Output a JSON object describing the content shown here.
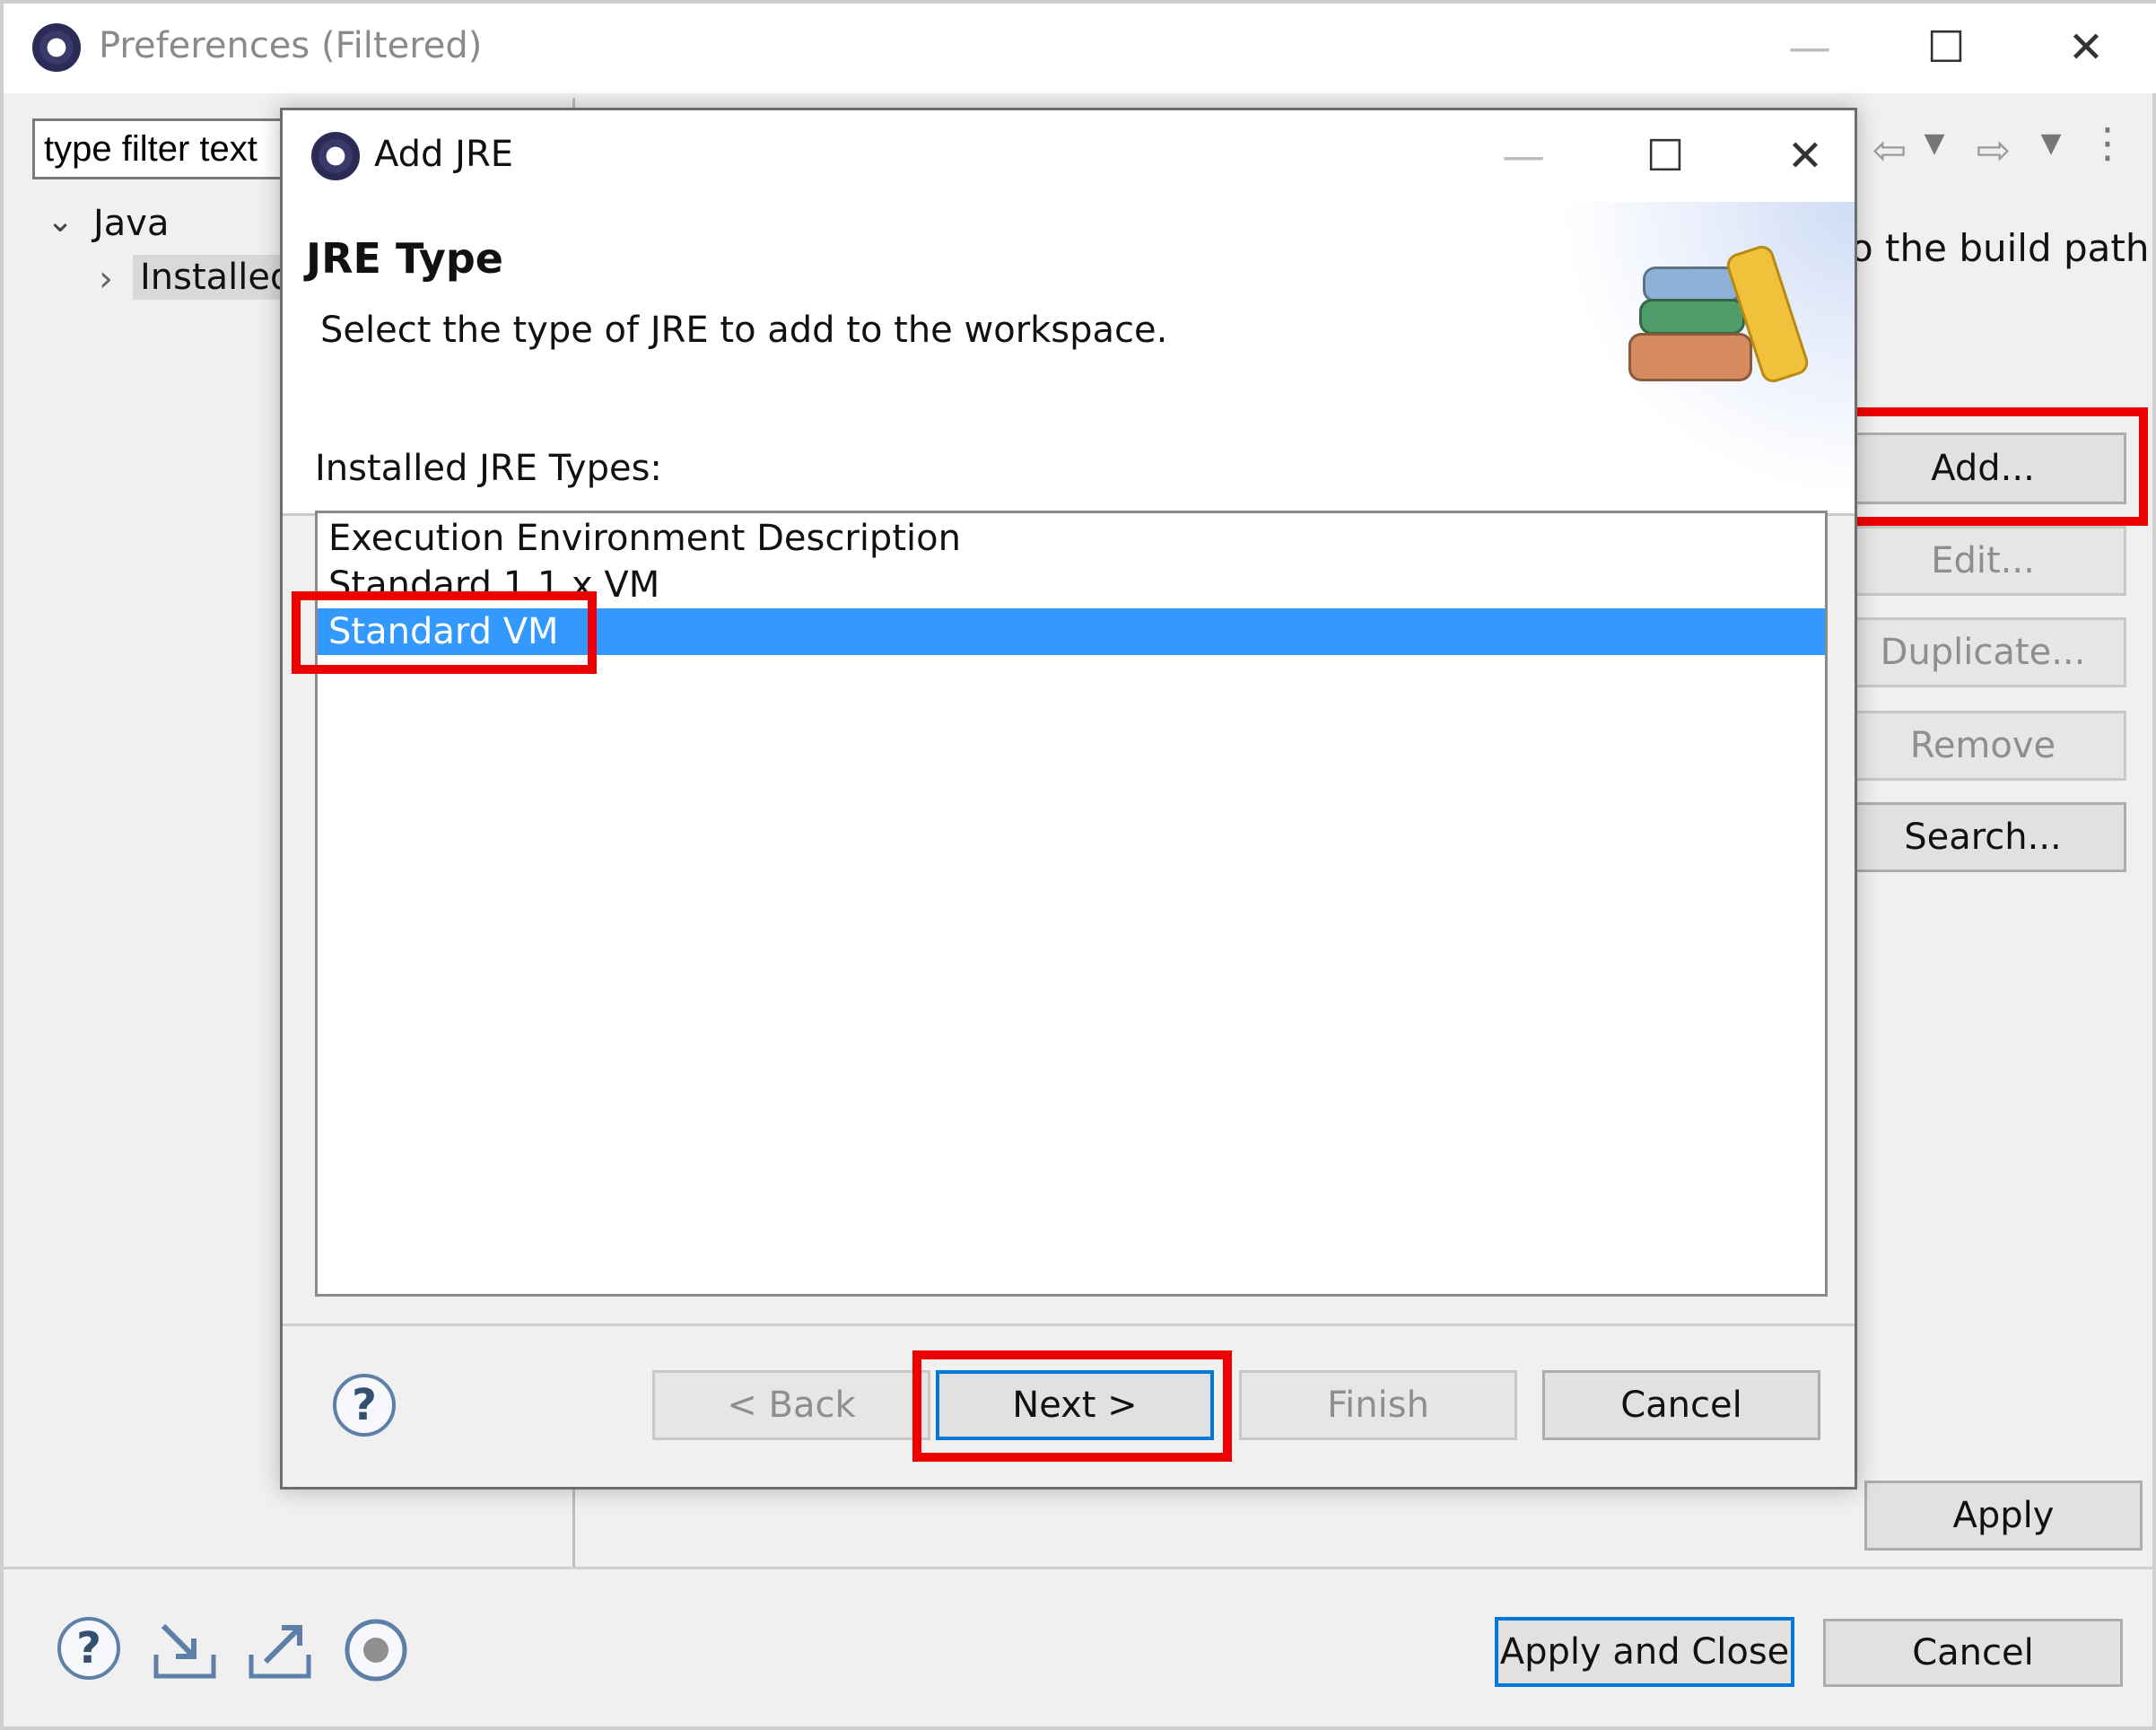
{
  "pref_window": {
    "title": "Preferences (Filtered)",
    "filter_text": "type filter text",
    "tree": {
      "root_label": "Java",
      "child_label": "Installed"
    },
    "description_partial": "o the build path",
    "buttons": {
      "add": "Add...",
      "edit": "Edit...",
      "duplicate": "Duplicate...",
      "remove": "Remove",
      "search": "Search...",
      "apply": "Apply",
      "apply_and_close": "Apply and Close",
      "cancel": "Cancel"
    },
    "window_controls": {
      "minimize": "—",
      "maximize": "☐",
      "close": "✕"
    }
  },
  "dialog": {
    "title": "Add JRE",
    "header_title": "JRE Type",
    "header_subtitle": "Select the type of JRE to add to the workspace.",
    "list_label": "Installed JRE Types:",
    "jre_types": [
      "Execution Environment Description",
      "Standard 1.1.x VM",
      "Standard VM"
    ],
    "selected_type": "Standard VM",
    "buttons": {
      "help": "?",
      "back": "< Back",
      "next": "Next >",
      "finish": "Finish",
      "cancel": "Cancel"
    },
    "window_controls": {
      "minimize": "—",
      "maximize": "☐",
      "close": "✕"
    }
  },
  "icons": {
    "app_icon": "eclipse-icon",
    "books_icon": "jre-books-icon",
    "help_icon": "help-icon",
    "import_icon": "import-icon",
    "export_icon": "export-icon",
    "record_icon": "record-icon"
  },
  "colors": {
    "selection": "#3399ff",
    "highlight_annotation": "#ee0000",
    "default_button_border": "#0078d7"
  }
}
